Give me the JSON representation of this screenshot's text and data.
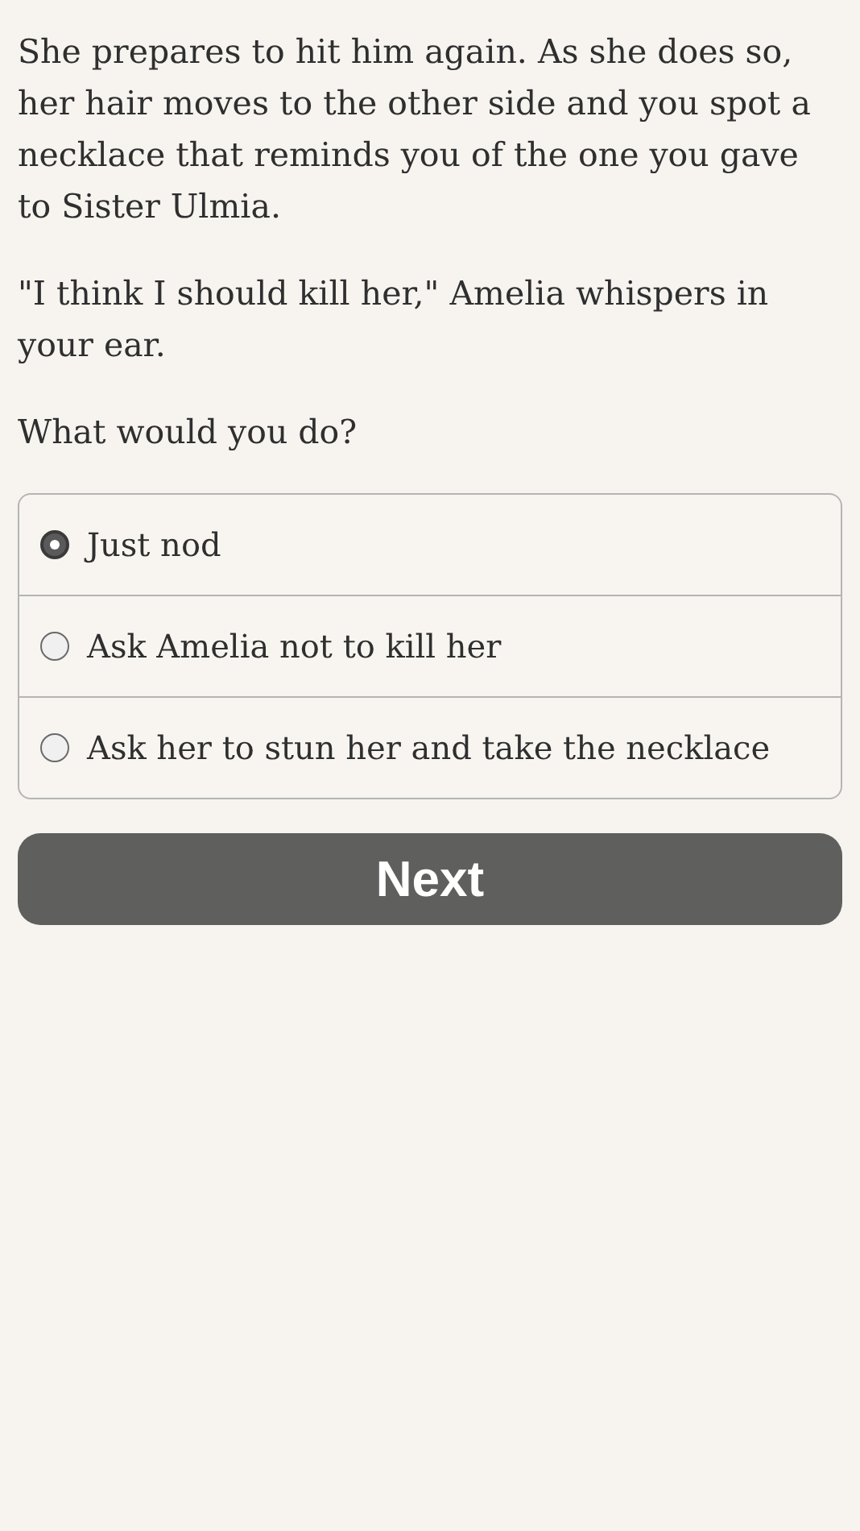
{
  "paragraphs": [
    "She prepares to hit him again. As she does so, her hair moves to the other side and you spot a necklace that reminds you of the one you gave to Sister Ulmia.",
    "\"I think I should kill her,\" Amelia whispers in your ear.",
    "What would you do?"
  ],
  "choices": [
    {
      "label": "Just nod",
      "selected": true
    },
    {
      "label": "Ask Amelia not to kill her",
      "selected": false
    },
    {
      "label": "Ask her to stun her and take the necklace",
      "selected": false
    }
  ],
  "button": {
    "label": "Next"
  }
}
